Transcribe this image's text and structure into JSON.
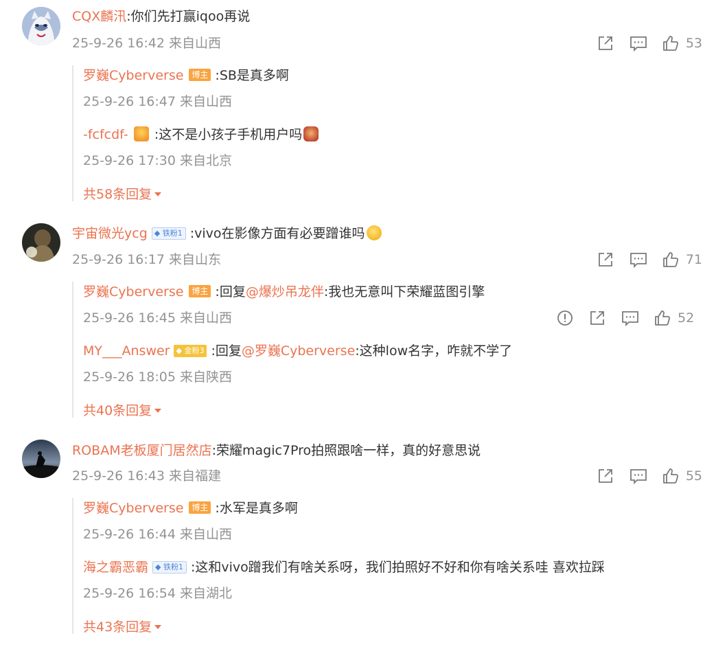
{
  "comments": [
    {
      "user": "CQX麟汛",
      "text": ":你们先打赢iqoo再说",
      "date": "25-9-26 16:42",
      "location": "来自山西",
      "likes": "53",
      "replies": [
        {
          "user": "罗巍Cyberverse",
          "badge": "博主",
          "text": ":SB是真多啊",
          "date": "25-9-26 16:47",
          "location": "来自山西"
        },
        {
          "user": "-fcfcdf-",
          "text": ":这不是小孩子手机用户吗",
          "date": "25-9-26 17:30",
          "location": "来自北京"
        }
      ],
      "more": "共58条回复"
    },
    {
      "user": "宇宙微光ycg",
      "badge": "铁粉1",
      "text": ":vivo在影像方面有必要蹭谁吗",
      "date": "25-9-26 16:17",
      "location": "来自山东",
      "likes": "71",
      "replies": [
        {
          "user": "罗巍Cyberverse",
          "badge": "博主",
          "text_prefix": ":回复",
          "mention": "@爆炒吊龙伴",
          "text": ":我也无意叫下荣耀蓝图引擎",
          "date": "25-9-26 16:45",
          "location": "来自山西",
          "likes": "52"
        },
        {
          "user": "MY___Answer",
          "badge": "金粉3",
          "text_prefix": ":回复",
          "mention": "@罗巍Cyberverse",
          "text": ":这种low名字，咋就不学了",
          "date": "25-9-26 18:05",
          "location": "来自陕西"
        }
      ],
      "more": "共40条回复"
    },
    {
      "user": "ROBAM老板厦门居然店",
      "text": ":荣耀magic7Pro拍照跟啥一样，真的好意思说",
      "date": "25-9-26 16:43",
      "location": "来自福建",
      "likes": "55",
      "replies": [
        {
          "user": "罗巍Cyberverse",
          "badge": "博主",
          "text": ":水军是真多啊",
          "date": "25-9-26 16:44",
          "location": "来自山西"
        },
        {
          "user": "海之霸恶霸",
          "badge": "铁粉1",
          "text": ":这和vivo蹭我们有啥关系呀，我们拍照好不好和你有啥关系哇 喜欢拉踩",
          "date": "25-9-26 16:54",
          "location": "来自湖北"
        }
      ],
      "more": "共43条回复"
    }
  ],
  "icons": [
    "share-icon",
    "comment-icon",
    "like-icon",
    "report-icon"
  ],
  "colors": {
    "username": "#eb7350",
    "meta": "#939393",
    "text": "#333333",
    "host_badge": "#f9a440"
  }
}
